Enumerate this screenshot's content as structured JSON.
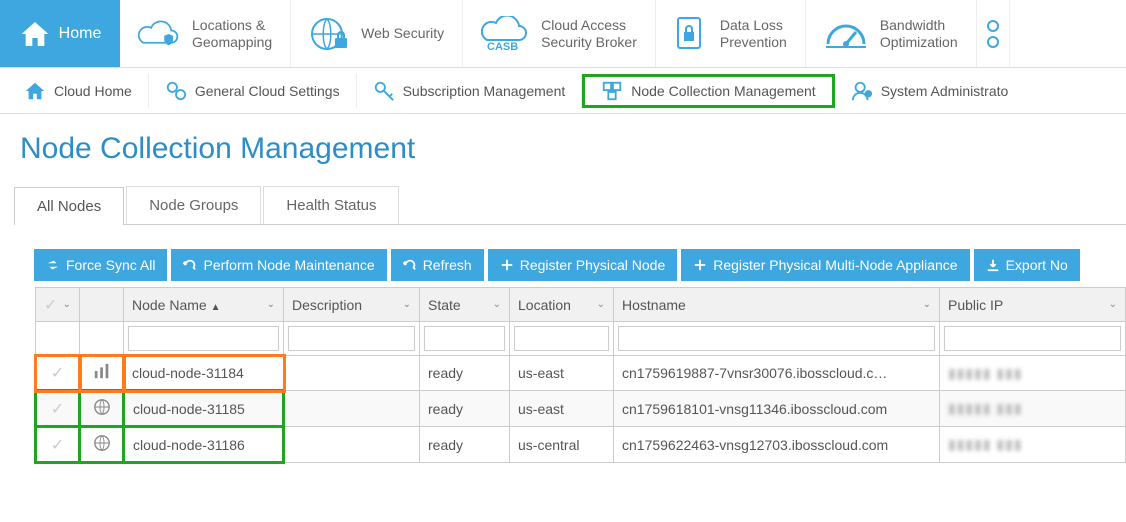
{
  "topnav": {
    "home": "Home",
    "items": [
      {
        "label": "Locations &\nGeomapping"
      },
      {
        "label": "Web Security"
      },
      {
        "label": "Cloud Access\nSecurity Broker",
        "acronym": "CASB"
      },
      {
        "label": "Data Loss\nPrevention"
      },
      {
        "label": "Bandwidth\nOptimization"
      }
    ]
  },
  "subnav": {
    "items": [
      {
        "label": "Cloud Home"
      },
      {
        "label": "General Cloud Settings"
      },
      {
        "label": "Subscription Management"
      },
      {
        "label": "Node Collection Management",
        "active": true
      },
      {
        "label": "System Administrato"
      }
    ]
  },
  "page_title": "Node Collection Management",
  "tabs": [
    {
      "label": "All Nodes",
      "active": true
    },
    {
      "label": "Node Groups"
    },
    {
      "label": "Health Status"
    }
  ],
  "toolbar": {
    "force_sync": "Force Sync All",
    "maintenance": "Perform Node Maintenance",
    "refresh": "Refresh",
    "register_node": "Register Physical Node",
    "register_multi": "Register Physical Multi-Node Appliance",
    "export": "Export No"
  },
  "columns": {
    "node_name": "Node Name",
    "description": "Description",
    "state": "State",
    "location": "Location",
    "hostname": "Hostname",
    "public_ip": "Public IP"
  },
  "rows": [
    {
      "name": "cloud-node-31184",
      "description": "",
      "state": "ready",
      "location": "us-east",
      "hostname": "cn1759619887-7vnsr30076.ibosscloud.c…",
      "public_ip": "▮▮▮▮▮ ▮▮▮",
      "row_icon": "stats"
    },
    {
      "name": "cloud-node-31185",
      "description": "",
      "state": "ready",
      "location": "us-east",
      "hostname": "cn1759618101-vnsg11346.ibosscloud.com",
      "public_ip": "▮▮▮▮▮ ▮▮▮",
      "row_icon": "globe"
    },
    {
      "name": "cloud-node-31186",
      "description": "",
      "state": "ready",
      "location": "us-central",
      "hostname": "cn1759622463-vnsg12703.ibosscloud.com",
      "public_ip": "▮▮▮▮▮ ▮▮▮",
      "row_icon": "globe"
    }
  ]
}
